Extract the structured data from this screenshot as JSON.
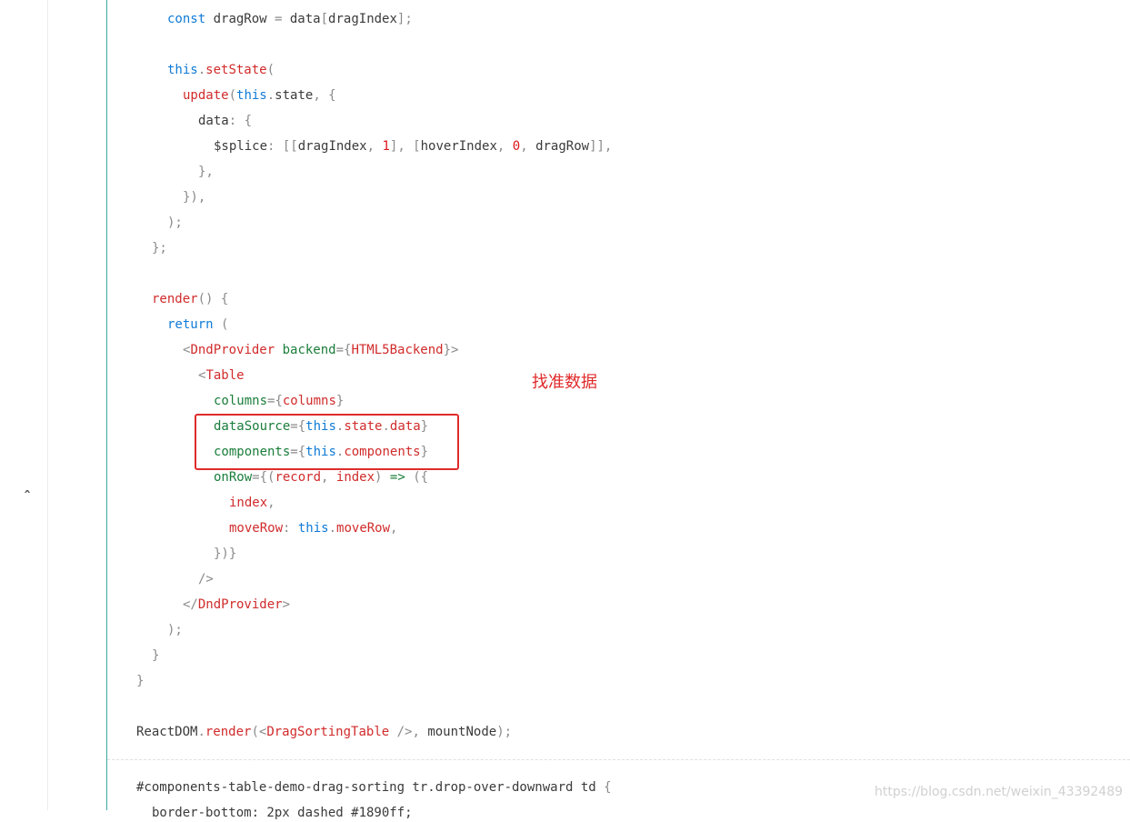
{
  "colors": {
    "default": "#3a3a3a",
    "keyword": "#0f7bd6",
    "func": "#d12b2b",
    "tag": "#d12b2b",
    "attr": "#1a7d3a",
    "punct": "#8a8a8a",
    "number": "#e0161c",
    "prop": "#1a7d3a",
    "annotation": "#e02b2b"
  },
  "gutter": {
    "fold_icon": "chevron-up-icon",
    "fold_glyph": "ˆ"
  },
  "code_lines": [
    {
      "indent": 4,
      "tokens": [
        [
          "keyword",
          "const"
        ],
        [
          "default",
          " dragRow "
        ],
        [
          "punct",
          "="
        ],
        [
          "default",
          " data"
        ],
        [
          "punct",
          "["
        ],
        [
          "default",
          "dragIndex"
        ],
        [
          "punct",
          "];"
        ]
      ]
    },
    {
      "indent": 0,
      "tokens": []
    },
    {
      "indent": 4,
      "tokens": [
        [
          "keyword",
          "this"
        ],
        [
          "punct",
          "."
        ],
        [
          "func",
          "setState"
        ],
        [
          "punct",
          "("
        ]
      ]
    },
    {
      "indent": 5,
      "tokens": [
        [
          "func",
          "update"
        ],
        [
          "punct",
          "("
        ],
        [
          "keyword",
          "this"
        ],
        [
          "punct",
          "."
        ],
        [
          "default",
          "state"
        ],
        [
          "punct",
          ", {"
        ]
      ]
    },
    {
      "indent": 6,
      "tokens": [
        [
          "default",
          "data"
        ],
        [
          "punct",
          ": {"
        ]
      ]
    },
    {
      "indent": 7,
      "tokens": [
        [
          "default",
          "$splice"
        ],
        [
          "punct",
          ": [["
        ],
        [
          "default",
          "dragIndex"
        ],
        [
          "punct",
          ", "
        ],
        [
          "number",
          "1"
        ],
        [
          "punct",
          "], ["
        ],
        [
          "default",
          "hoverIndex"
        ],
        [
          "punct",
          ", "
        ],
        [
          "number",
          "0"
        ],
        [
          "punct",
          ", "
        ],
        [
          "default",
          "dragRow"
        ],
        [
          "punct",
          "]],"
        ]
      ]
    },
    {
      "indent": 6,
      "tokens": [
        [
          "punct",
          "},"
        ]
      ]
    },
    {
      "indent": 5,
      "tokens": [
        [
          "punct",
          "}),"
        ]
      ]
    },
    {
      "indent": 4,
      "tokens": [
        [
          "punct",
          ");"
        ]
      ]
    },
    {
      "indent": 3,
      "tokens": [
        [
          "punct",
          "};"
        ]
      ]
    },
    {
      "indent": 0,
      "tokens": []
    },
    {
      "indent": 3,
      "tokens": [
        [
          "func",
          "render"
        ],
        [
          "punct",
          "() {"
        ]
      ]
    },
    {
      "indent": 4,
      "tokens": [
        [
          "keyword",
          "return"
        ],
        [
          "punct",
          " ("
        ]
      ]
    },
    {
      "indent": 5,
      "tokens": [
        [
          "punct",
          "<"
        ],
        [
          "tag",
          "DndProvider"
        ],
        [
          "attr",
          " backend"
        ],
        [
          "punct",
          "={"
        ],
        [
          "tag",
          "HTML5Backend"
        ],
        [
          "punct",
          "}>"
        ]
      ]
    },
    {
      "indent": 6,
      "tokens": [
        [
          "punct",
          "<"
        ],
        [
          "tag",
          "Table"
        ]
      ]
    },
    {
      "indent": 7,
      "tokens": [
        [
          "attr",
          "columns"
        ],
        [
          "punct",
          "={"
        ],
        [
          "func",
          "columns"
        ],
        [
          "punct",
          "}"
        ]
      ]
    },
    {
      "indent": 7,
      "tokens": [
        [
          "attr",
          "dataSource"
        ],
        [
          "punct",
          "={"
        ],
        [
          "keyword",
          "this"
        ],
        [
          "punct",
          "."
        ],
        [
          "func",
          "state"
        ],
        [
          "punct",
          "."
        ],
        [
          "func",
          "data"
        ],
        [
          "punct",
          "}"
        ]
      ]
    },
    {
      "indent": 7,
      "tokens": [
        [
          "attr",
          "components"
        ],
        [
          "punct",
          "={"
        ],
        [
          "keyword",
          "this"
        ],
        [
          "punct",
          "."
        ],
        [
          "func",
          "components"
        ],
        [
          "punct",
          "}"
        ]
      ]
    },
    {
      "indent": 7,
      "tokens": [
        [
          "attr",
          "onRow"
        ],
        [
          "punct",
          "={("
        ],
        [
          "func",
          "record"
        ],
        [
          "punct",
          ", "
        ],
        [
          "func",
          "index"
        ],
        [
          "punct",
          ") "
        ],
        [
          "attr",
          "=>"
        ],
        [
          "punct",
          " ({"
        ]
      ]
    },
    {
      "indent": 8,
      "tokens": [
        [
          "func",
          "index"
        ],
        [
          "punct",
          ","
        ]
      ]
    },
    {
      "indent": 8,
      "tokens": [
        [
          "func",
          "moveRow"
        ],
        [
          "punct",
          ": "
        ],
        [
          "keyword",
          "this"
        ],
        [
          "punct",
          "."
        ],
        [
          "func",
          "moveRow"
        ],
        [
          "punct",
          ","
        ]
      ]
    },
    {
      "indent": 7,
      "tokens": [
        [
          "punct",
          "})}"
        ]
      ]
    },
    {
      "indent": 6,
      "tokens": [
        [
          "punct",
          "/>"
        ]
      ]
    },
    {
      "indent": 5,
      "tokens": [
        [
          "punct",
          "</"
        ],
        [
          "tag",
          "DndProvider"
        ],
        [
          "punct",
          ">"
        ]
      ]
    },
    {
      "indent": 4,
      "tokens": [
        [
          "punct",
          ");"
        ]
      ]
    },
    {
      "indent": 3,
      "tokens": [
        [
          "punct",
          "}"
        ]
      ]
    },
    {
      "indent": 2,
      "tokens": [
        [
          "punct",
          "}"
        ]
      ]
    },
    {
      "indent": 0,
      "tokens": []
    },
    {
      "indent": 2,
      "tokens": [
        [
          "default",
          "ReactDOM"
        ],
        [
          "punct",
          "."
        ],
        [
          "func",
          "render"
        ],
        [
          "punct",
          "(<"
        ],
        [
          "tag",
          "DragSortingTable"
        ],
        [
          "punct",
          " />, "
        ],
        [
          "default",
          "mountNode"
        ],
        [
          "punct",
          ");"
        ]
      ]
    }
  ],
  "css_snippet": [
    {
      "indent": 2,
      "tokens": [
        [
          "default",
          "#components-table-demo-drag-sorting tr.drop-over-downward td "
        ],
        [
          "punct",
          "{"
        ]
      ]
    },
    {
      "indent": 3,
      "tokens": [
        [
          "default",
          "border-bottom: 2px dashed #1890ff;"
        ]
      ]
    }
  ],
  "annotation_text": "找准数据",
  "watermark_text": "https://blog.csdn.net/weixin_43392489"
}
